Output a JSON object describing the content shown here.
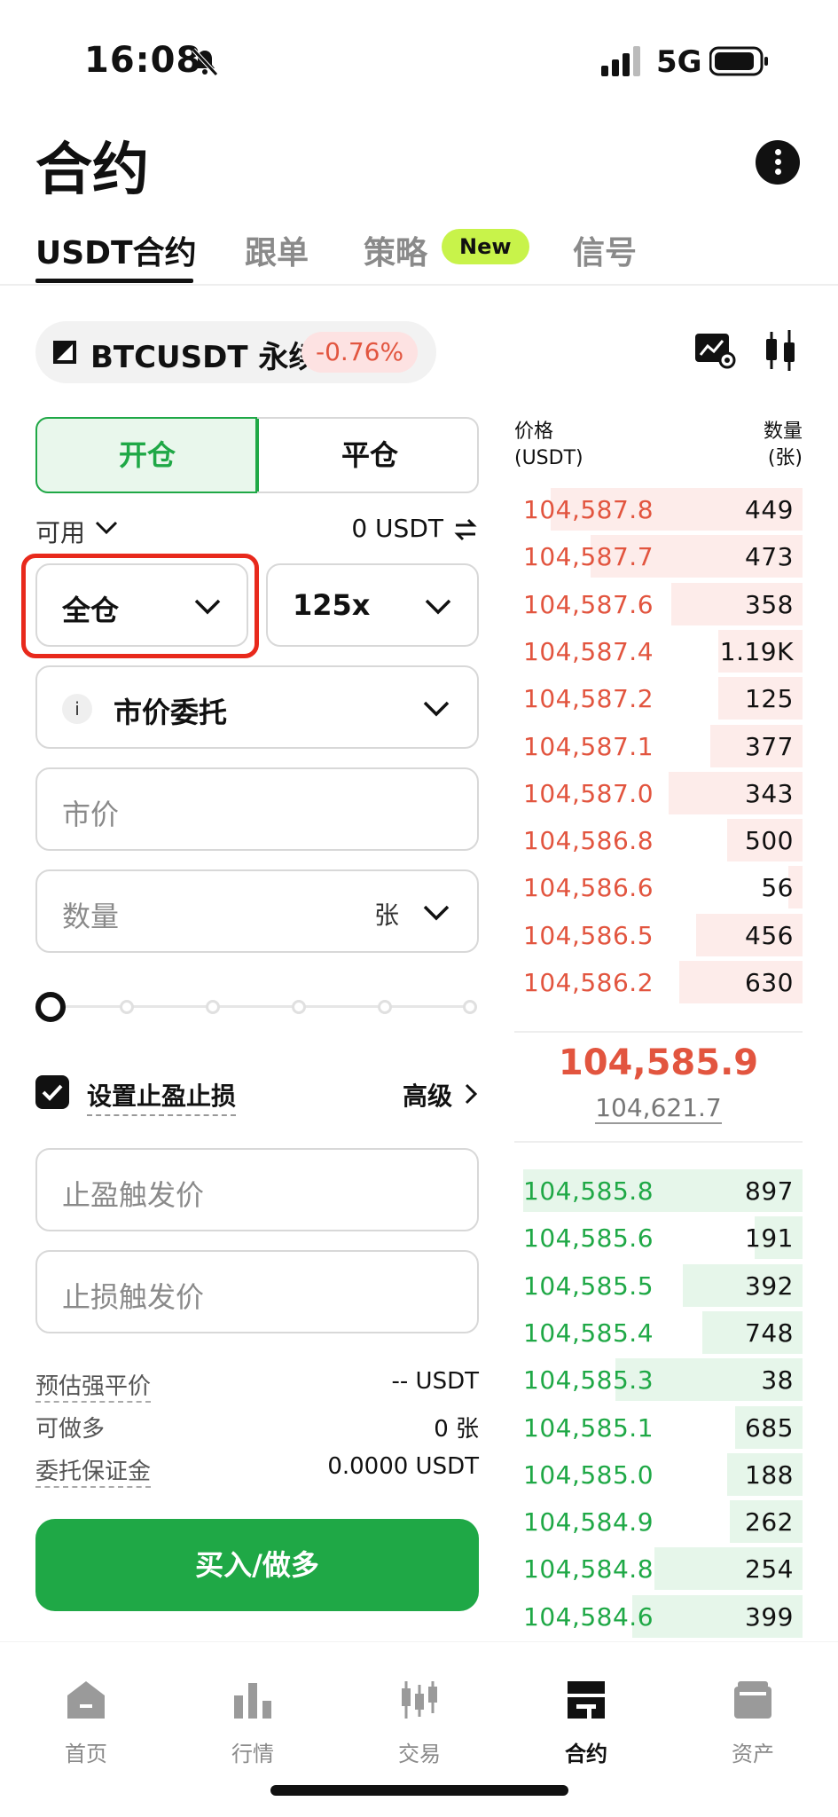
{
  "status_bar": {
    "time": "16:08",
    "network": "5G"
  },
  "header": {
    "title": "合约"
  },
  "tabs": [
    {
      "label": "USDT合约"
    },
    {
      "label": "跟单"
    },
    {
      "label": "策略",
      "badge": "New"
    },
    {
      "label": "信号"
    }
  ],
  "symbol": {
    "name": "BTCUSDT 永续",
    "change": "-0.76%"
  },
  "order_form": {
    "open_label": "开仓",
    "close_label": "平仓",
    "available_label": "可用",
    "available_value": "0 USDT",
    "margin_mode": "全仓",
    "leverage": "125x",
    "order_type_info": "i",
    "order_type": "市价委托",
    "price_placeholder": "市价",
    "quantity_placeholder": "数量",
    "quantity_unit": "张",
    "slider_percent": 0,
    "tpsl_label": "设置止盈止损",
    "tpsl_checked": true,
    "advanced_label": "高级",
    "tp_placeholder": "止盈触发价",
    "sl_placeholder": "止损触发价",
    "summary": [
      {
        "key": "预估强平价",
        "value": "-- USDT"
      },
      {
        "key": "可做多",
        "value": "0 张"
      },
      {
        "key": "委托保证金",
        "value": "0.0000 USDT"
      }
    ],
    "buy_label": "买入/做多"
  },
  "order_book": {
    "price_header": "价格",
    "price_unit": "(USDT)",
    "qty_header": "数量",
    "qty_unit": "(张)",
    "asks": [
      {
        "price": "104,587.8",
        "qty": "449",
        "depth": 0.9
      },
      {
        "price": "104,587.7",
        "qty": "473",
        "depth": 0.76
      },
      {
        "price": "104,587.6",
        "qty": "358",
        "depth": 0.47
      },
      {
        "price": "104,587.4",
        "qty": "1.19K",
        "depth": 0.3
      },
      {
        "price": "104,587.2",
        "qty": "125",
        "depth": 0.3
      },
      {
        "price": "104,587.1",
        "qty": "377",
        "depth": 0.33
      },
      {
        "price": "104,587.0",
        "qty": "343",
        "depth": 0.48
      },
      {
        "price": "104,586.8",
        "qty": "500",
        "depth": 0.27
      },
      {
        "price": "104,586.6",
        "qty": "56",
        "depth": 0.05
      },
      {
        "price": "104,586.5",
        "qty": "456",
        "depth": 0.38
      },
      {
        "price": "104,586.2",
        "qty": "630",
        "depth": 0.44
      }
    ],
    "mid_price": "104,585.9",
    "mark_price": "104,621.7",
    "bids": [
      {
        "price": "104,585.8",
        "qty": "897",
        "depth": 1.0
      },
      {
        "price": "104,585.6",
        "qty": "191",
        "depth": 0.17
      },
      {
        "price": "104,585.5",
        "qty": "392",
        "depth": 0.43
      },
      {
        "price": "104,585.4",
        "qty": "748",
        "depth": 0.36
      },
      {
        "price": "104,585.3",
        "qty": "38",
        "depth": 0.67
      },
      {
        "price": "104,585.1",
        "qty": "685",
        "depth": 0.24
      },
      {
        "price": "104,585.0",
        "qty": "188",
        "depth": 0.27
      },
      {
        "price": "104,584.9",
        "qty": "262",
        "depth": 0.26
      },
      {
        "price": "104,584.8",
        "qty": "254",
        "depth": 0.53
      },
      {
        "price": "104,584.6",
        "qty": "399",
        "depth": 0.61
      }
    ]
  },
  "nav": [
    {
      "label": "首页",
      "icon": "home-icon"
    },
    {
      "label": "行情",
      "icon": "market-icon"
    },
    {
      "label": "交易",
      "icon": "trade-icon"
    },
    {
      "label": "合约",
      "icon": "futures-icon",
      "active": true
    },
    {
      "label": "资产",
      "icon": "wallet-icon"
    }
  ],
  "colors": {
    "green": "#1fa846",
    "red": "#e2553f",
    "badge": "#c8f34a",
    "highlight": "#e8291c"
  }
}
